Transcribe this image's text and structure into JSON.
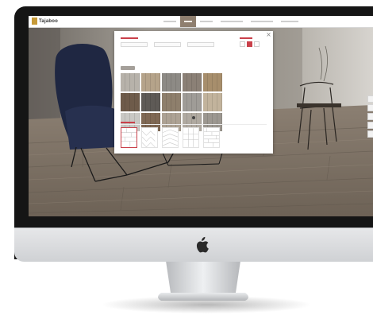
{
  "site": {
    "logo_text": "Tajaboo",
    "nav": [
      "",
      "",
      "",
      "",
      "",
      ""
    ],
    "active_nav_index": 1
  },
  "picker": {
    "swatches": [
      {
        "name": "grey-oak",
        "color": "#b7b2aa"
      },
      {
        "name": "beige-oak",
        "color": "#b5a38a"
      },
      {
        "name": "ash-grey",
        "color": "#8d8a85"
      },
      {
        "name": "smoked-oak",
        "color": "#8b8076"
      },
      {
        "name": "honey-oak",
        "color": "#a78e6c"
      },
      {
        "name": "dark-walnut",
        "color": "#6e5b4a"
      },
      {
        "name": "charcoal",
        "color": "#5e5a56"
      },
      {
        "name": "driftwood",
        "color": "#8e7f6c"
      },
      {
        "name": "stone-grey",
        "color": "#9f9c97"
      },
      {
        "name": "light-oak",
        "color": "#c2b39c"
      },
      {
        "name": "silver-grey",
        "color": "#c9c8c4"
      },
      {
        "name": "walnut",
        "color": "#7f6854"
      },
      {
        "name": "taupe",
        "color": "#ada294"
      },
      {
        "name": "greige",
        "color": "#b0aaa1"
      },
      {
        "name": "weathered-grey",
        "color": "#9c9790"
      }
    ],
    "selected_swatch_index": 7,
    "patterns": [
      {
        "name": "plank"
      },
      {
        "name": "herringbone"
      },
      {
        "name": "chevron"
      },
      {
        "name": "tile"
      },
      {
        "name": "stagger"
      }
    ],
    "selected_pattern_index": 0
  },
  "colors": {
    "accent": "#c9404a",
    "nav_active": "#8f7f6f"
  }
}
